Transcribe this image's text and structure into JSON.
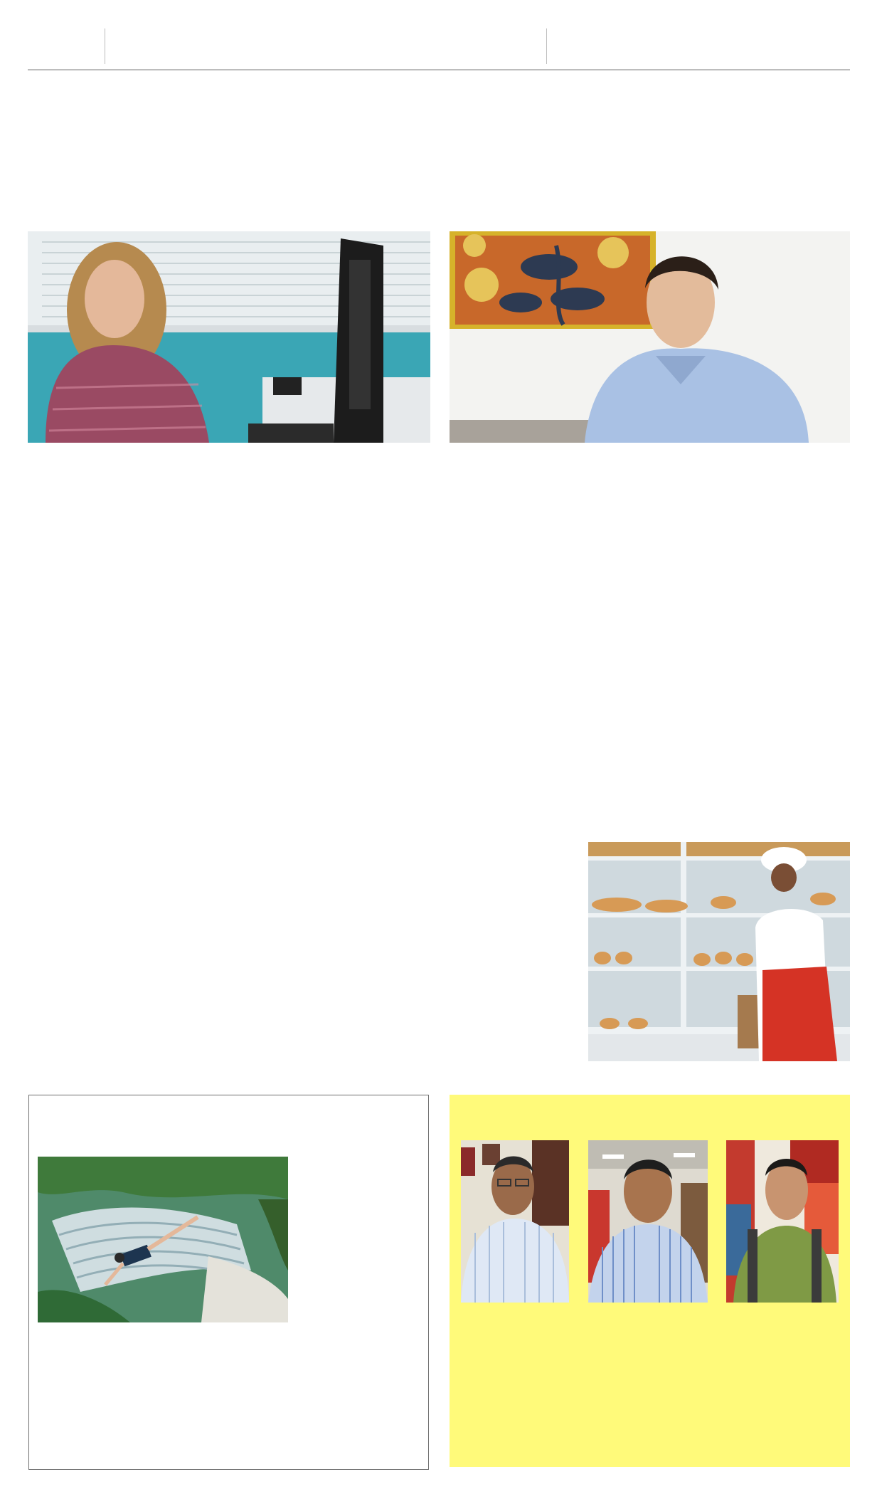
{
  "page": {
    "background": "#ffffff"
  },
  "colors": {
    "rule": "#bdbdbd",
    "box_border": "#6d6d6d",
    "sidebar_yellow": "#fffa7a"
  },
  "photos": {
    "woman_at_computer": {
      "icon": "photo-woman-computer"
    },
    "man_blue_shirt": {
      "icon": "photo-man-blue-shirt"
    },
    "bakery": {
      "icon": "photo-bakery-counter"
    },
    "waterfall_jump": {
      "icon": "photo-waterfall-jump"
    },
    "interviewees": [
      {
        "icon": "photo-man-glasses"
      },
      {
        "icon": "photo-man-striped-shirt"
      },
      {
        "icon": "photo-man-green-shirt"
      }
    ]
  }
}
